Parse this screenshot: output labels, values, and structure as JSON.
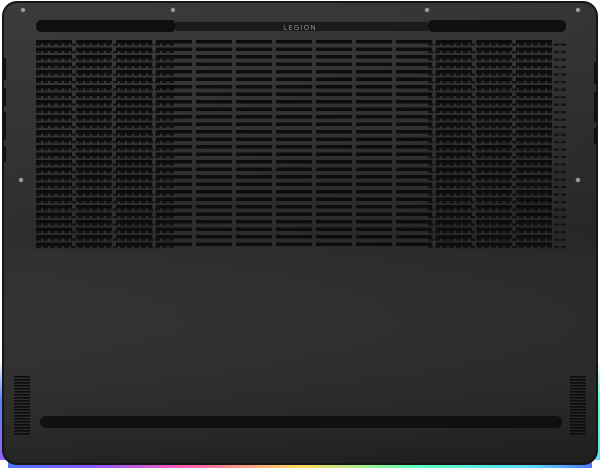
{
  "device": {
    "logo_text": "LEGION",
    "body_color": "#2a2a2a",
    "edge_color": "#151515",
    "vent_color": "#0c0c0c",
    "rgb_colors": [
      "#2f5fff",
      "#7a3cff",
      "#ff3fa4",
      "#ffd23f",
      "#3fffb0",
      "#3fd0ff"
    ]
  }
}
